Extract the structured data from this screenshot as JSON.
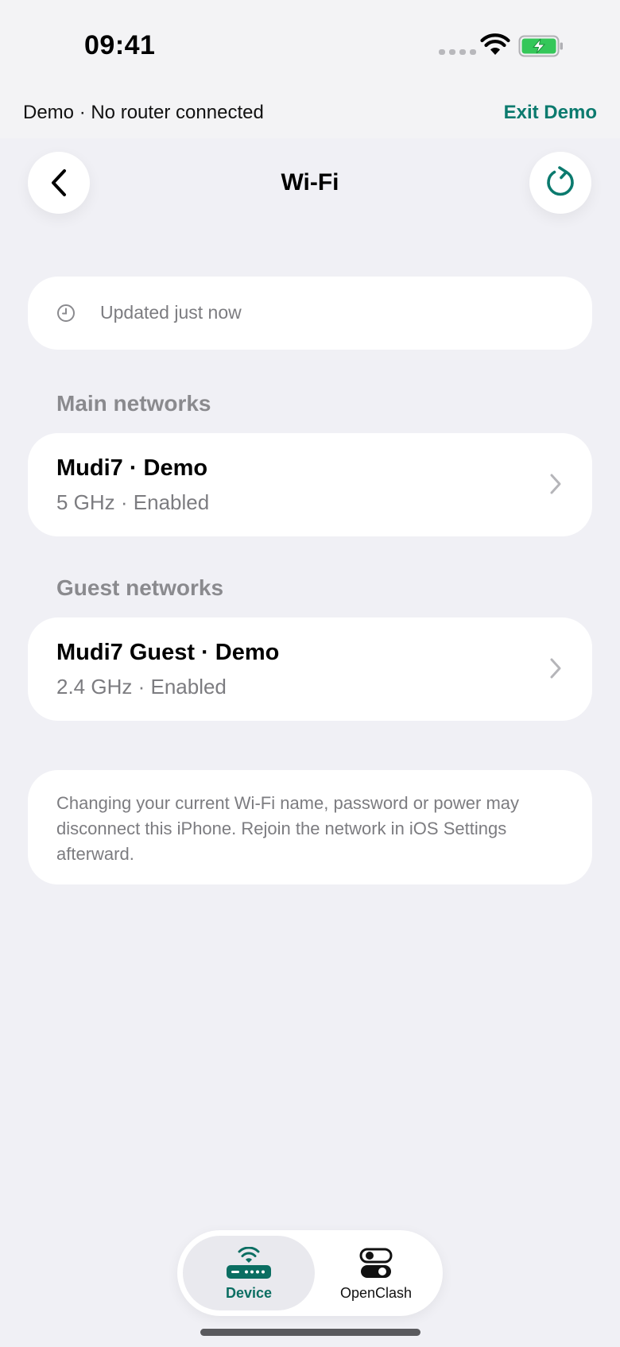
{
  "status_bar": {
    "time": "09:41",
    "icons": [
      "signal-dots-icon",
      "wifi-icon",
      "battery-charging-icon"
    ],
    "battery_color": "#34c759"
  },
  "demo_banner": {
    "text": "Demo · No router connected",
    "exit_label": "Exit Demo"
  },
  "header": {
    "title": "Wi-Fi",
    "back_icon": "chevron-left-icon",
    "refresh_icon": "refresh-icon"
  },
  "updated": {
    "icon": "clock-icon",
    "text": "Updated just now"
  },
  "sections": [
    {
      "label": "Main networks",
      "networks": [
        {
          "name": "Mudi7 · Demo",
          "detail": "5 GHz · Enabled"
        }
      ]
    },
    {
      "label": "Guest networks",
      "networks": [
        {
          "name": "Mudi7 Guest · Demo",
          "detail": "2.4 GHz · Enabled"
        }
      ]
    }
  ],
  "note": "Changing your current Wi-Fi name, password or power may disconnect this iPhone. Rejoin the network in iOS Settings afterward.",
  "tabbar": {
    "tabs": [
      {
        "label": "Device",
        "icon": "router-icon",
        "selected": true
      },
      {
        "label": "OpenClash",
        "icon": "toggles-icon",
        "selected": false
      }
    ]
  },
  "colors": {
    "accent": "#0b7a6e",
    "background": "#f0f0f5",
    "secondary_text": "#7c7c80"
  }
}
